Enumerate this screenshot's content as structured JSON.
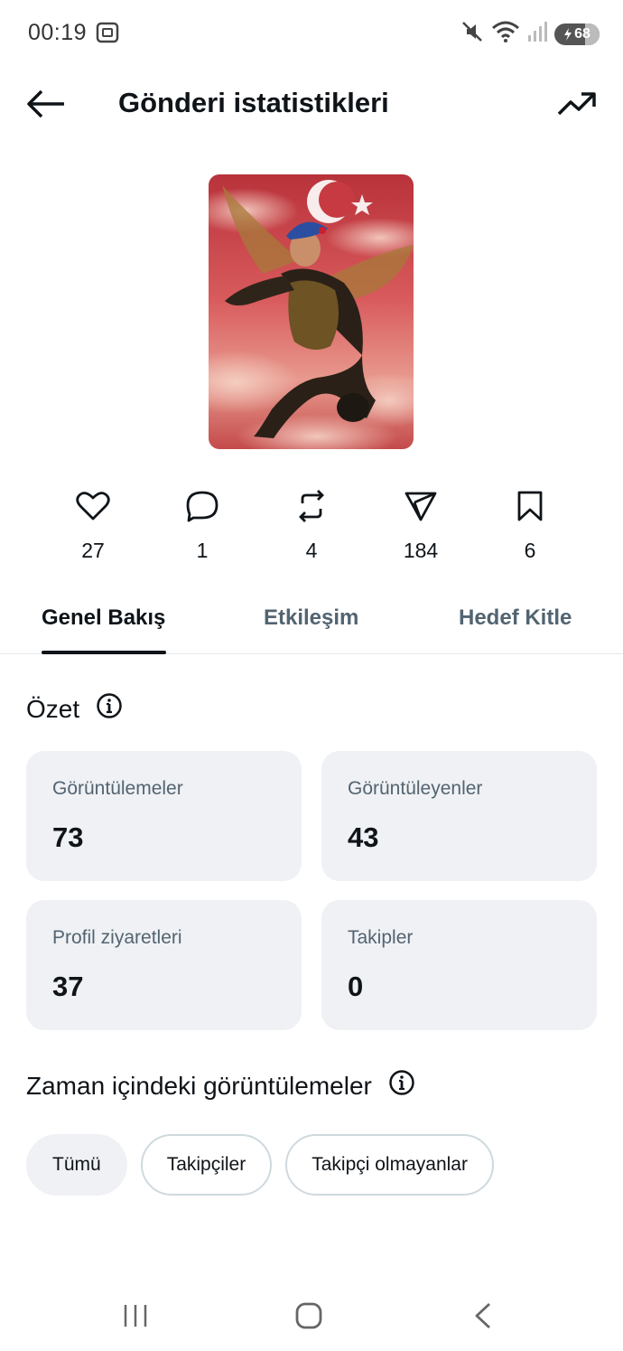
{
  "status_bar": {
    "time": "00:19",
    "battery": "68",
    "icons": [
      "screenshot-icon",
      "mute-icon",
      "wifi-icon",
      "signal-icon",
      "battery-icon"
    ]
  },
  "header": {
    "title": "Gönderi istatistikleri",
    "back_icon": "arrow-left-icon",
    "trend_icon": "trending-up-icon"
  },
  "post": {
    "image_icon": "post-image"
  },
  "engagement": [
    {
      "icon": "heart-icon",
      "count": "27"
    },
    {
      "icon": "reply-icon",
      "count": "1"
    },
    {
      "icon": "repost-icon",
      "count": "4"
    },
    {
      "icon": "share-icon",
      "count": "184"
    },
    {
      "icon": "bookmark-icon",
      "count": "6"
    }
  ],
  "tabs": [
    {
      "label": "Genel Bakış",
      "active": true
    },
    {
      "label": "Etkileşim",
      "active": false
    },
    {
      "label": "Hedef Kitle",
      "active": false
    }
  ],
  "summary": {
    "title": "Özet",
    "cards": [
      {
        "label": "Görüntülemeler",
        "value": "73"
      },
      {
        "label": "Görüntüleyenler",
        "value": "43"
      },
      {
        "label": "Profil ziyaretleri",
        "value": "37"
      },
      {
        "label": "Takipler",
        "value": "0"
      }
    ]
  },
  "views_over_time": {
    "title": "Zaman içindeki görüntülemeler",
    "filters": [
      {
        "label": "Tümü",
        "selected": true
      },
      {
        "label": "Takipçiler",
        "selected": false
      },
      {
        "label": "Takipçi olmayanlar",
        "selected": false
      }
    ]
  },
  "colors": {
    "text_primary": "#0f1419",
    "text_secondary": "#536471",
    "card_bg": "#eff1f4",
    "chip_border": "#cfd9de"
  }
}
